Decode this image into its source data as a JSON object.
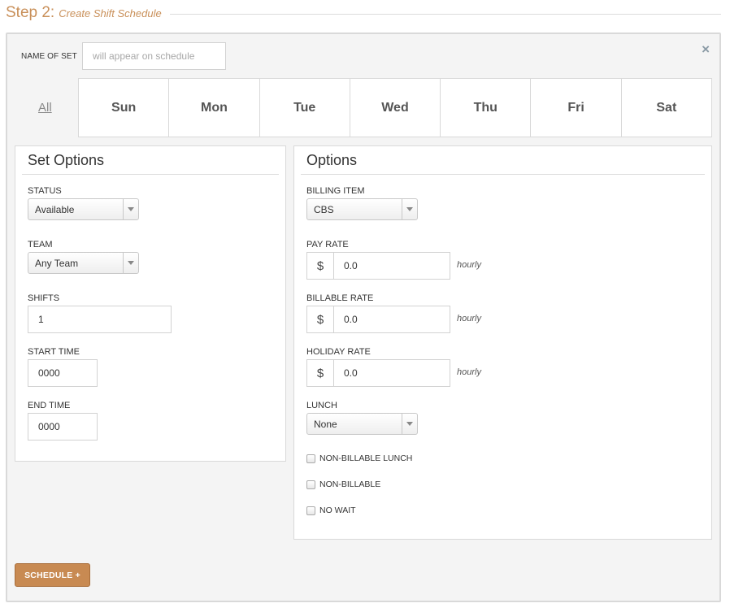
{
  "step": {
    "number": "Step 2:",
    "title": "Create Shift Schedule"
  },
  "name_of_set": {
    "label": "NAME OF SET",
    "placeholder": "will appear on schedule"
  },
  "days": {
    "all": "All",
    "items": [
      "Sun",
      "Mon",
      "Tue",
      "Wed",
      "Thu",
      "Fri",
      "Sat"
    ]
  },
  "set_options": {
    "title": "Set Options",
    "status": {
      "label": "STATUS",
      "value": "Available"
    },
    "team": {
      "label": "TEAM",
      "value": "Any Team"
    },
    "shifts": {
      "label": "SHIFTS",
      "value": "1"
    },
    "start_time": {
      "label": "START TIME",
      "value": "0000"
    },
    "end_time": {
      "label": "END TIME",
      "value": "0000"
    }
  },
  "options": {
    "title": "Options",
    "billing_item": {
      "label": "BILLING ITEM",
      "value": "CBS"
    },
    "pay_rate": {
      "label": "PAY RATE",
      "currency": "$",
      "value": "0.0",
      "unit": "hourly"
    },
    "billable_rate": {
      "label": "BILLABLE RATE",
      "currency": "$",
      "value": "0.0",
      "unit": "hourly"
    },
    "holiday_rate": {
      "label": "HOLIDAY RATE",
      "currency": "$",
      "value": "0.0",
      "unit": "hourly"
    },
    "lunch": {
      "label": "LUNCH",
      "value": "None"
    },
    "checkboxes": [
      "NON-BILLABLE LUNCH",
      "NON-BILLABLE",
      "NO WAIT"
    ]
  },
  "schedule_button": "SCHEDULE +",
  "close_glyph": "×",
  "colors": {
    "accent": "#c88a52",
    "step_text": "#c9905a",
    "panel_bg": "#f4f4f4"
  }
}
